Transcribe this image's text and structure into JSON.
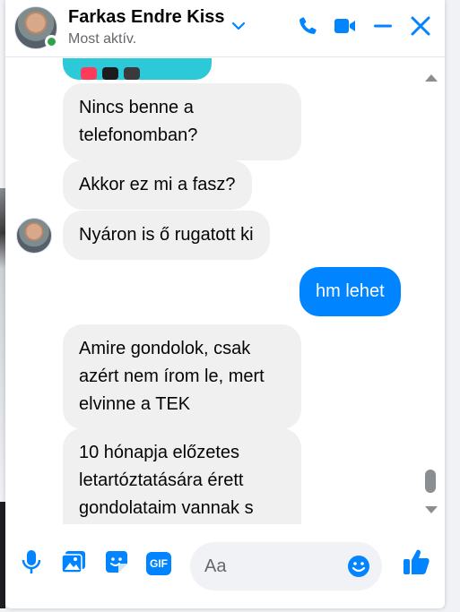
{
  "contact": {
    "name": "Farkas Endre Kiss",
    "status": "Most aktív."
  },
  "header_icons": [
    "chevron-down-icon",
    "phone-icon",
    "video-icon",
    "minimize-icon",
    "close-icon"
  ],
  "messages": [
    {
      "direction": "in",
      "text": "Nincs benne a telefonomban?"
    },
    {
      "direction": "in",
      "text": "Akkor ez mi a fasz?"
    },
    {
      "direction": "in",
      "text": "Nyáron is ő rugatott ki"
    },
    {
      "direction": "out",
      "text": "hm lehet"
    },
    {
      "direction": "in",
      "text": "Amire gondolok, csak azért nem írom le, mert elvinne a TEK"
    },
    {
      "direction": "in",
      "text": "10 hónapja előzetes letartóztatására érett gondolataim vannak s"
    }
  ],
  "composer": {
    "placeholder": "Aa",
    "gif_label": "GIF",
    "icons": [
      "microphone-icon",
      "image-icon",
      "sticker-icon",
      "gif-icon",
      "emoji-icon",
      "like-icon"
    ]
  },
  "colors": {
    "accent": "#0084ff",
    "incoming_bubble": "#f0f0f0",
    "online": "#31a24c"
  }
}
